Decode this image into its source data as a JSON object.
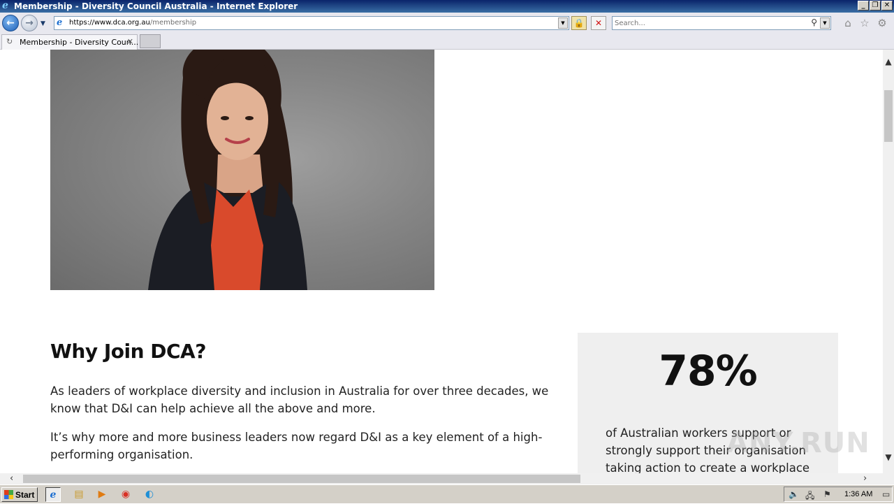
{
  "window": {
    "title": "Membership - Diversity Council Australia - Internet Explorer"
  },
  "address_bar": {
    "url_prefix": "https://www.",
    "url_host": "dca.org.au",
    "url_path": "/membership"
  },
  "search": {
    "placeholder": "Search..."
  },
  "tabs": [
    {
      "label": "Membership - Diversity Coun..."
    }
  ],
  "content": {
    "heading": "Why Join DCA?",
    "paragraphs": [
      "As leaders of workplace diversity and inclusion in Australia for over three decades, we know that D&I can help achieve all the above and more.",
      "It’s why more and more business leaders now regard D&I as a key element of a high-performing organisation."
    ],
    "stat": {
      "value": "78%",
      "description": "of Australian workers support or strongly support their organisation taking action to create a workplace"
    }
  },
  "watermark": "ANY.RUN",
  "taskbar": {
    "start_label": "Start",
    "clock": "1:36 AM"
  },
  "colors": {
    "titlebar": "#0a246a",
    "stat_background": "#efefef",
    "taskbar": "#d4d0c8"
  }
}
